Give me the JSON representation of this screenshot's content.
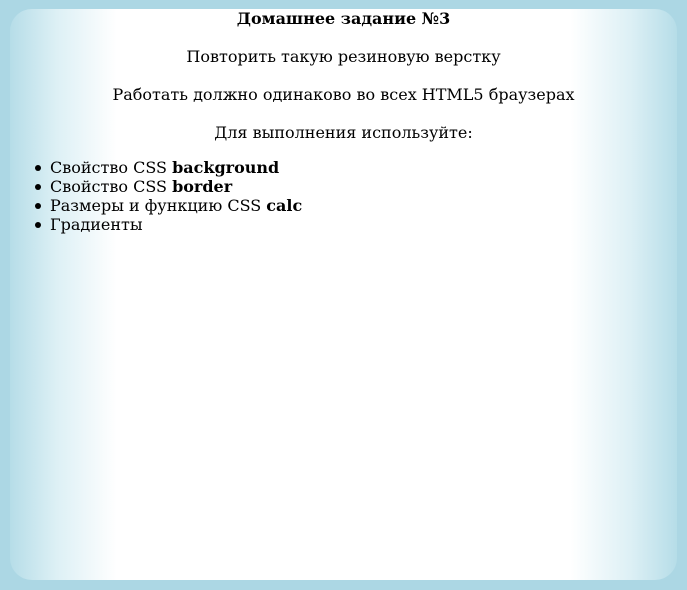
{
  "page": {
    "title": "Домашнее задание №3",
    "paragraphs": [
      "Повторить такую резиновую верстку",
      "Работать должно одинаково во всех HTML5 браузерах",
      "Для выполнения используйте:"
    ],
    "list": [
      {
        "text": "Свойство CSS ",
        "bold": "background"
      },
      {
        "text": "Свойство CSS ",
        "bold": "border"
      },
      {
        "text": "Размеры и функцию CSS ",
        "bold": "calc"
      },
      {
        "text": "Градиенты",
        "bold": ""
      }
    ]
  },
  "colors": {
    "page_background": "#acd7e4",
    "card_edge": "#b6dde8",
    "card_center": "#ffffff"
  }
}
